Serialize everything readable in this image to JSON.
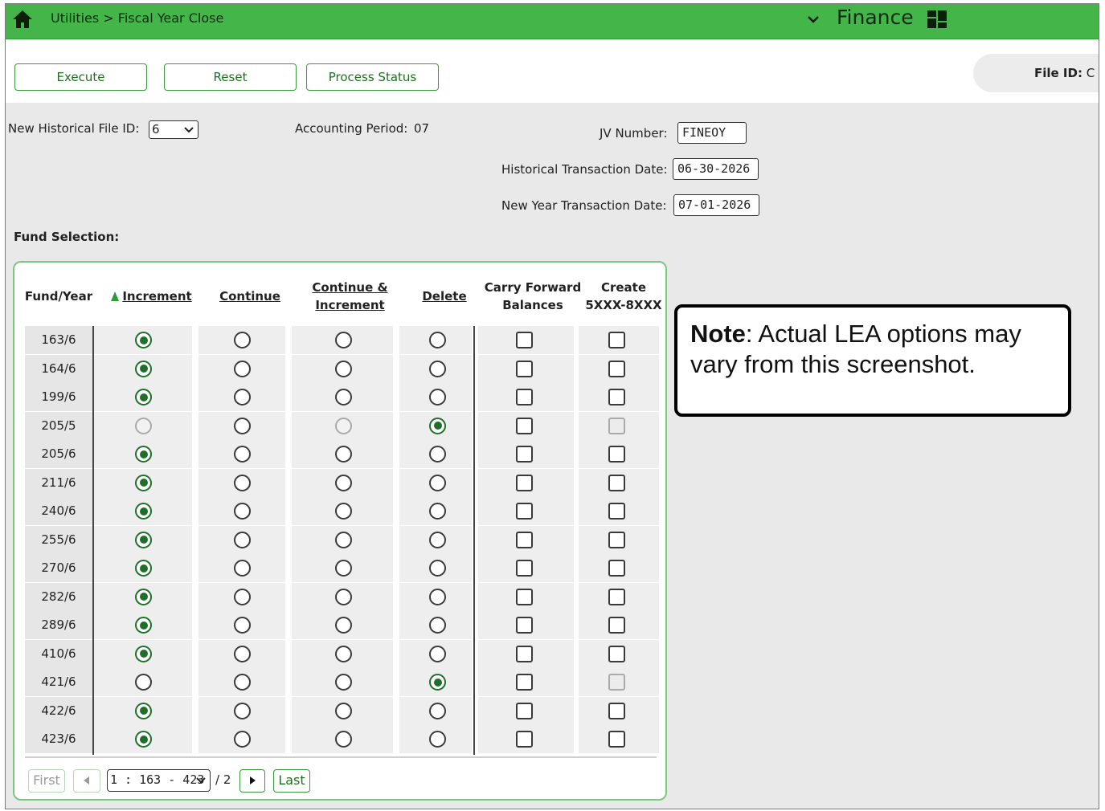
{
  "topbar": {
    "breadcrumb": "Utilities > Fiscal Year Close",
    "app_title": "Finance",
    "home_icon": "home-icon",
    "chevron_icon": "chevron-down-icon",
    "dashboard_icon": "dashboard-icon",
    "bar_color": "#43b549"
  },
  "toolbar": {
    "execute_label": "Execute",
    "reset_label": "Reset",
    "process_status_label": "Process Status",
    "file_id_label": "File ID:",
    "file_id_value": "C"
  },
  "form": {
    "hist_file_id_label": "New Historical File ID:",
    "hist_file_id_value": "6",
    "accounting_period_label": "Accounting Period:",
    "accounting_period_value": "07",
    "jv_number_label": "JV Number:",
    "jv_number_value": "FINEOY",
    "hist_trans_date_label": "Historical Transaction Date:",
    "hist_trans_date_value": "06-30-2026",
    "new_year_trans_date_label": "New Year Transaction Date:",
    "new_year_trans_date_value": "07-01-2026"
  },
  "fund_selection": {
    "title": "Fund Selection:",
    "headers": {
      "fund_year": "Fund/Year",
      "increment": "Increment",
      "continue": "Continue",
      "continue_increment_1": "Continue &",
      "continue_increment_2": "Increment",
      "delete": "Delete",
      "carry_forward_1": "Carry Forward",
      "carry_forward_2": "Balances",
      "create_1": "Create",
      "create_2": "5XXX-8XXX"
    },
    "rows": [
      {
        "fund": "163/6",
        "choice": "increment",
        "disabled": false
      },
      {
        "fund": "164/6",
        "choice": "increment",
        "disabled": false
      },
      {
        "fund": "199/6",
        "choice": "increment",
        "disabled": false
      },
      {
        "fund": "205/5",
        "choice": "delete",
        "disabled": true
      },
      {
        "fund": "205/6",
        "choice": "increment",
        "disabled": false
      },
      {
        "fund": "211/6",
        "choice": "increment",
        "disabled": false
      },
      {
        "fund": "240/6",
        "choice": "increment",
        "disabled": false
      },
      {
        "fund": "255/6",
        "choice": "increment",
        "disabled": false
      },
      {
        "fund": "270/6",
        "choice": "increment",
        "disabled": false
      },
      {
        "fund": "282/6",
        "choice": "increment",
        "disabled": false
      },
      {
        "fund": "289/6",
        "choice": "increment",
        "disabled": false
      },
      {
        "fund": "410/6",
        "choice": "increment",
        "disabled": false
      },
      {
        "fund": "421/6",
        "choice": "delete",
        "disabled": false,
        "create_disabled": true
      },
      {
        "fund": "422/6",
        "choice": "increment",
        "disabled": false
      },
      {
        "fund": "423/6",
        "choice": "increment",
        "disabled": false
      }
    ],
    "pager": {
      "first_label": "First",
      "last_label": "Last",
      "page_select_value": "1 : 163 - 423",
      "page_total": "/ 2"
    }
  },
  "note": {
    "bold": "Note",
    "text": ": Actual LEA options may vary from this screenshot."
  }
}
